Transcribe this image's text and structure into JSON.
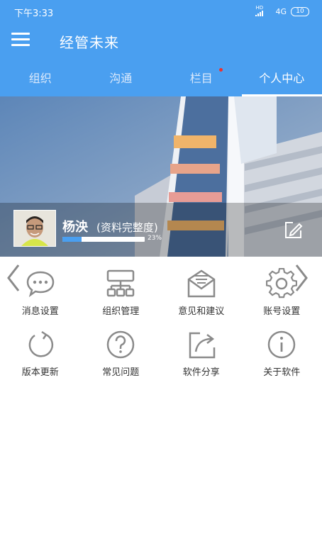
{
  "status_bar": {
    "time": "下午3:33",
    "hd_label": "HD",
    "network": "4G",
    "battery": "10"
  },
  "app_bar": {
    "title": "经管未来",
    "menu_icon": "hamburger-menu-icon"
  },
  "tabs": [
    {
      "label": "组织",
      "active": false,
      "badge": false
    },
    {
      "label": "沟通",
      "active": false,
      "badge": false
    },
    {
      "label": "栏目",
      "active": false,
      "badge": true
    },
    {
      "label": "个人中心",
      "active": true,
      "badge": false
    }
  ],
  "profile": {
    "name": "杨泱",
    "completion_label": "(资料完整度)",
    "completion_percent": 23,
    "completion_text": "23%",
    "edit_icon": "edit-icon"
  },
  "menu_grid": [
    {
      "label": "消息设置",
      "icon": "chat-bubble-icon"
    },
    {
      "label": "组织管理",
      "icon": "org-chart-icon"
    },
    {
      "label": "意见和建议",
      "icon": "mail-icon"
    },
    {
      "label": "账号设置",
      "icon": "gear-icon"
    },
    {
      "label": "版本更新",
      "icon": "refresh-icon"
    },
    {
      "label": "常见问题",
      "icon": "question-icon"
    },
    {
      "label": "软件分享",
      "icon": "share-icon"
    },
    {
      "label": "关于软件",
      "icon": "info-icon"
    }
  ],
  "colors": {
    "primary": "#4a9ff0",
    "badge": "#f0302c",
    "icon_gray": "#8a8a8a"
  }
}
